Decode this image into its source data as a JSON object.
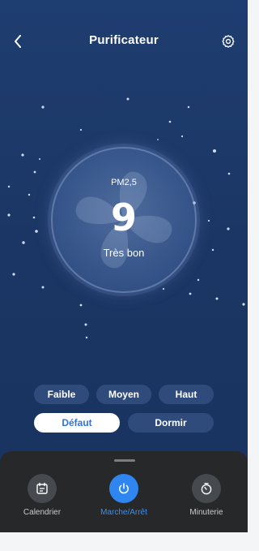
{
  "header": {
    "title": "Purificateur",
    "back_icon": "chevron-left-icon",
    "settings_icon": "gear-icon"
  },
  "reading": {
    "label": "PM2,5",
    "value": "9",
    "quality": "Très bon"
  },
  "fan_speeds": {
    "low": "Faible",
    "medium": "Moyen",
    "high": "Haut"
  },
  "modes": {
    "default": "Défaut",
    "sleep": "Dormir",
    "selected": "Défaut"
  },
  "actions": {
    "schedule": {
      "label": "Calendrier",
      "icon": "calendar-icon"
    },
    "power": {
      "label": "Marche/Arrêt",
      "icon": "power-icon"
    },
    "timer": {
      "label": "Minuterie",
      "icon": "timer-icon"
    }
  },
  "colors": {
    "background": "#1b3664",
    "accent": "#2f86f0",
    "pill": "#2f4b7c",
    "sheet": "#262829"
  }
}
